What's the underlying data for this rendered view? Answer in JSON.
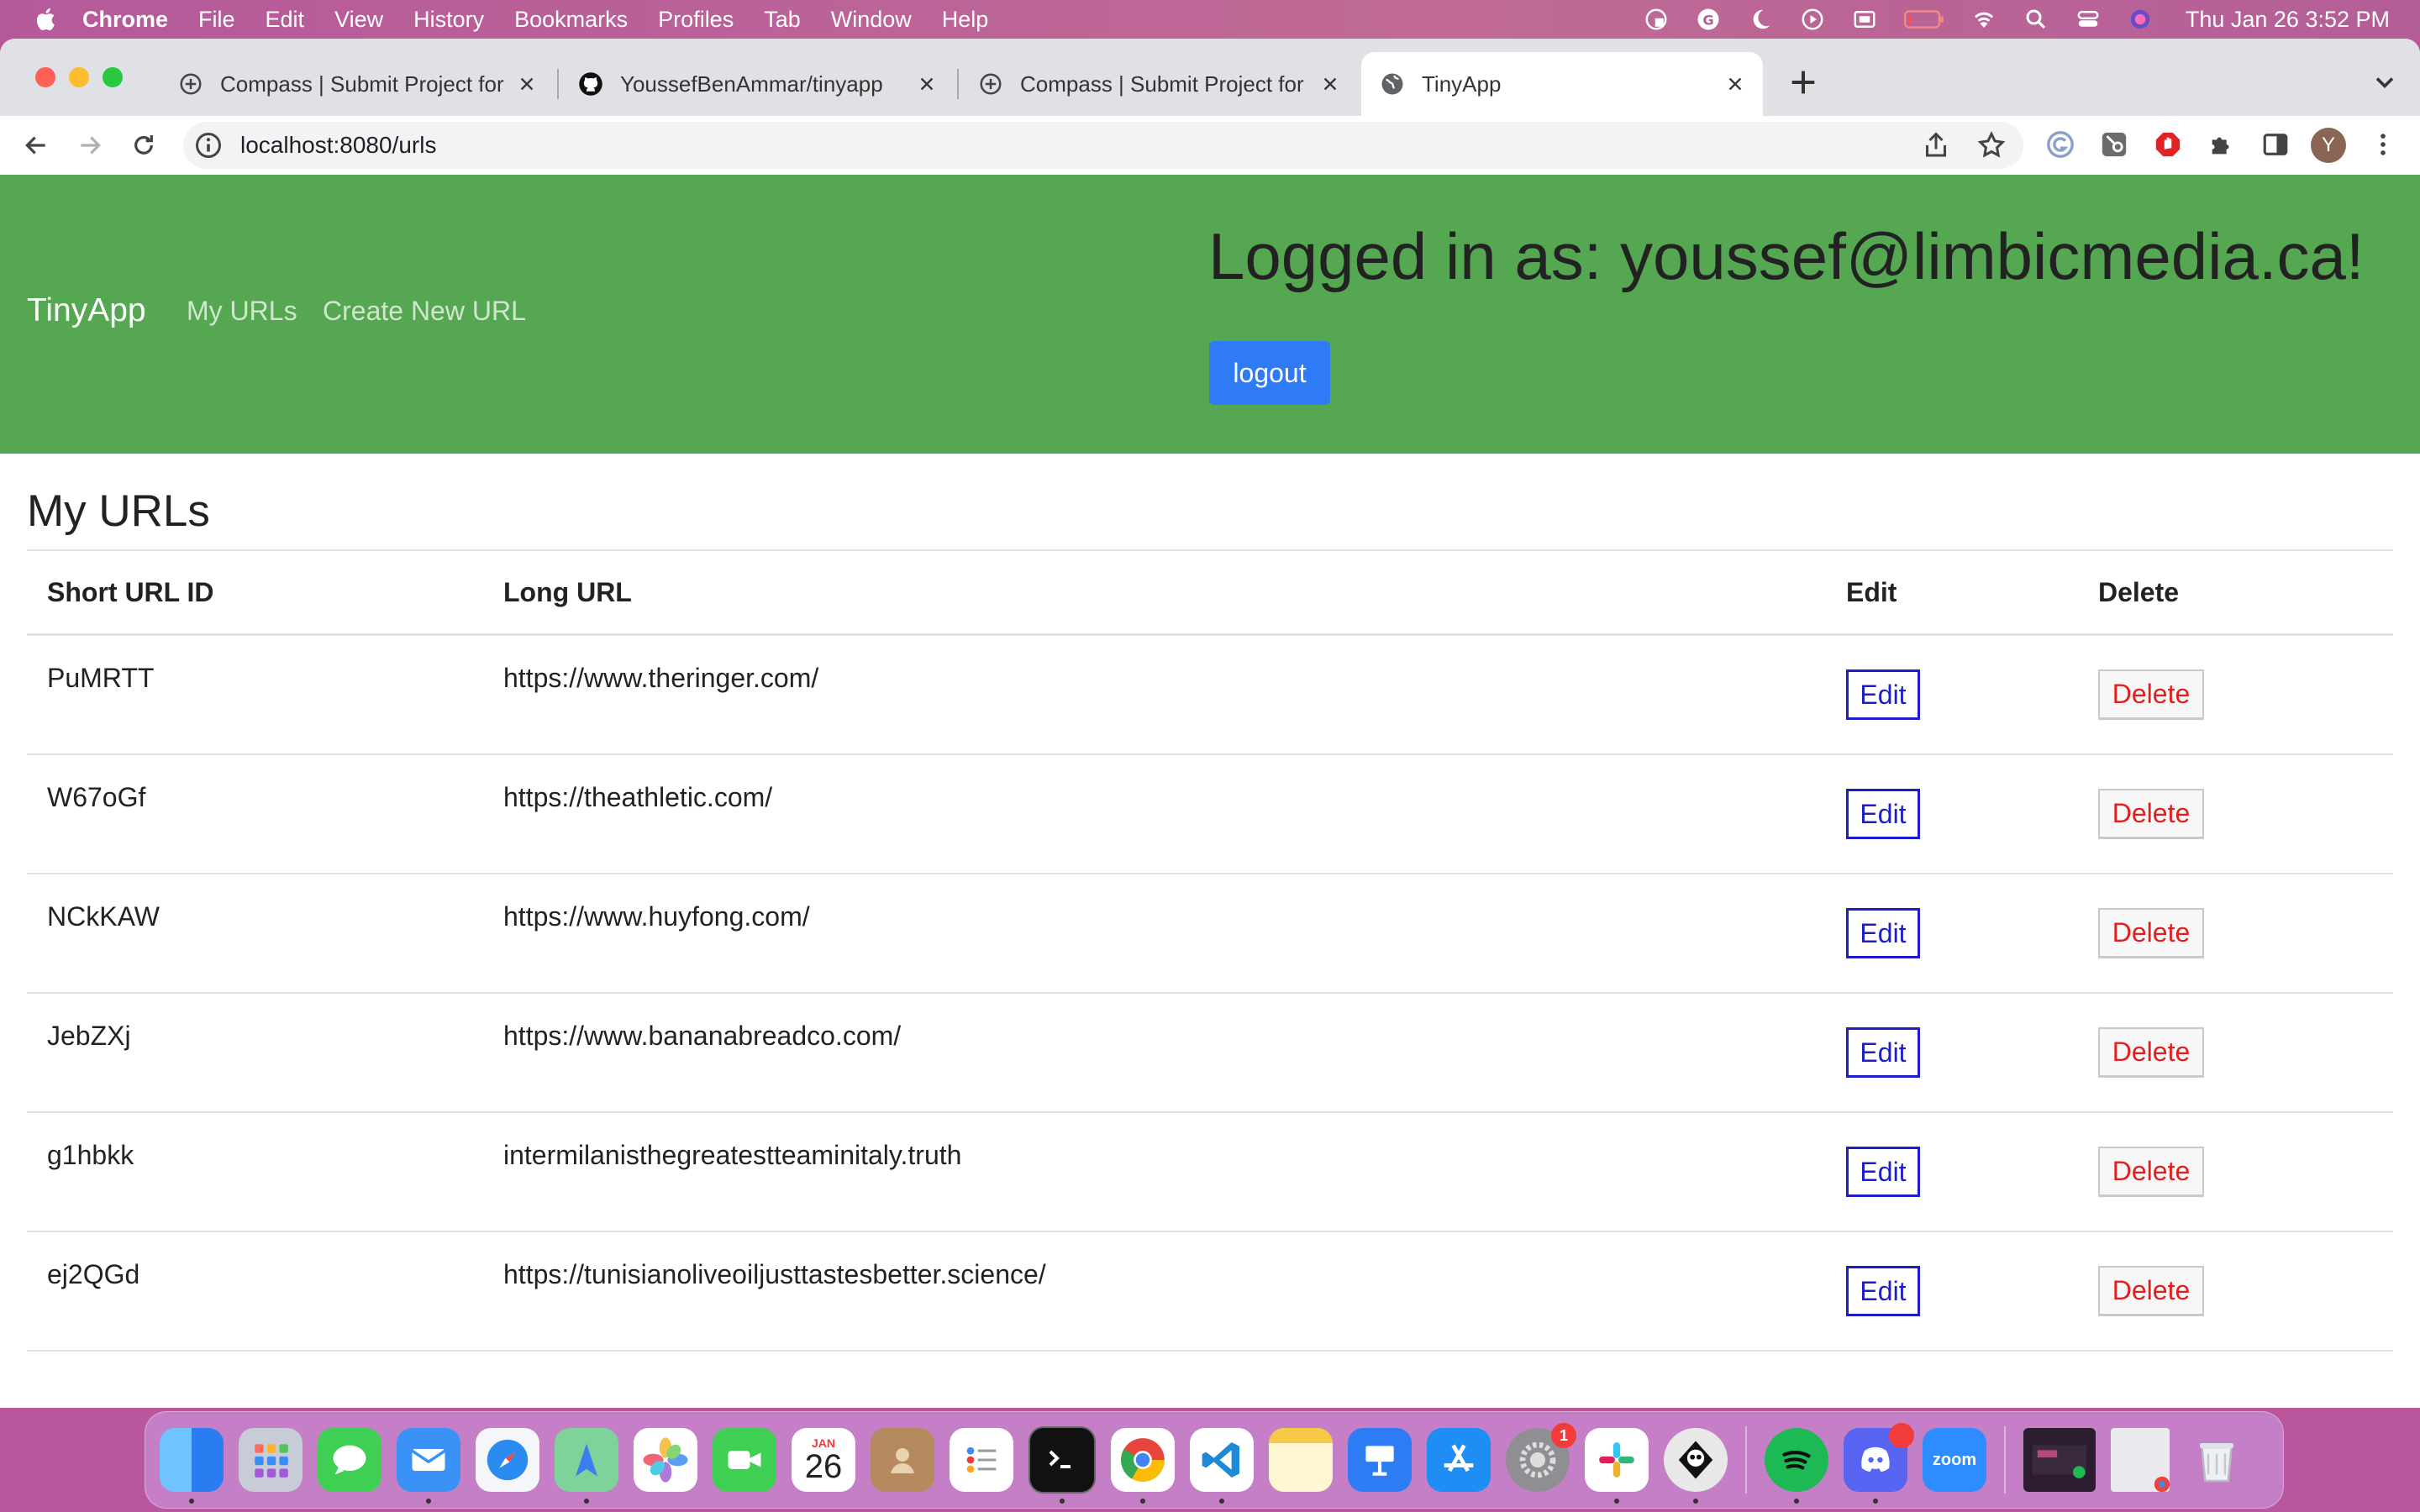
{
  "menubar": {
    "app": "Chrome",
    "items": [
      "File",
      "Edit",
      "View",
      "History",
      "Bookmarks",
      "Profiles",
      "Tab",
      "Window",
      "Help"
    ],
    "clock": "Thu Jan 26  3:52 PM"
  },
  "tabs": [
    {
      "title": "Compass | Submit Project for E",
      "icon": "compass-icon"
    },
    {
      "title": "YoussefBenAmmar/tinyapp",
      "icon": "github-icon"
    },
    {
      "title": "Compass | Submit Project for E",
      "icon": "compass-icon"
    },
    {
      "title": "TinyApp",
      "icon": "globe-icon",
      "active": true
    }
  ],
  "address": {
    "url": "localhost:8080/urls"
  },
  "profile": {
    "initial": "Y"
  },
  "navbar": {
    "brand": "TinyApp",
    "links": [
      "My URLs",
      "Create New URL"
    ],
    "logged_in": "Logged in as: youssef@limbicmedia.ca!",
    "logout": "logout"
  },
  "main": {
    "title": "My URLs",
    "columns": [
      "Short URL ID",
      "Long URL",
      "Edit",
      "Delete"
    ],
    "edit_label": "Edit",
    "delete_label": "Delete",
    "rows": [
      {
        "id": "PuMRTT",
        "long": "https://www.theringer.com/"
      },
      {
        "id": "W67oGf",
        "long": "https://theathletic.com/"
      },
      {
        "id": "NCkKAW",
        "long": "https://www.huyfong.com/"
      },
      {
        "id": "JebZXj",
        "long": "https://www.bananabreadco.com/"
      },
      {
        "id": "g1hbkk",
        "long": "intermilanisthegreatestteaminitaly.truth"
      },
      {
        "id": "ej2QGd",
        "long": "https://tunisianoliveoiljusttastesbetter.science/"
      }
    ]
  },
  "dock": {
    "calendar_month": "JAN",
    "calendar_day": "26",
    "settings_badge": "1",
    "zoom_label": "zoom",
    "colors": {
      "finder": "#3d8df5",
      "messages": "#3fcf52",
      "spotify": "#1db954",
      "discord": "#5865f2",
      "zoom": "#2d8cff"
    }
  }
}
